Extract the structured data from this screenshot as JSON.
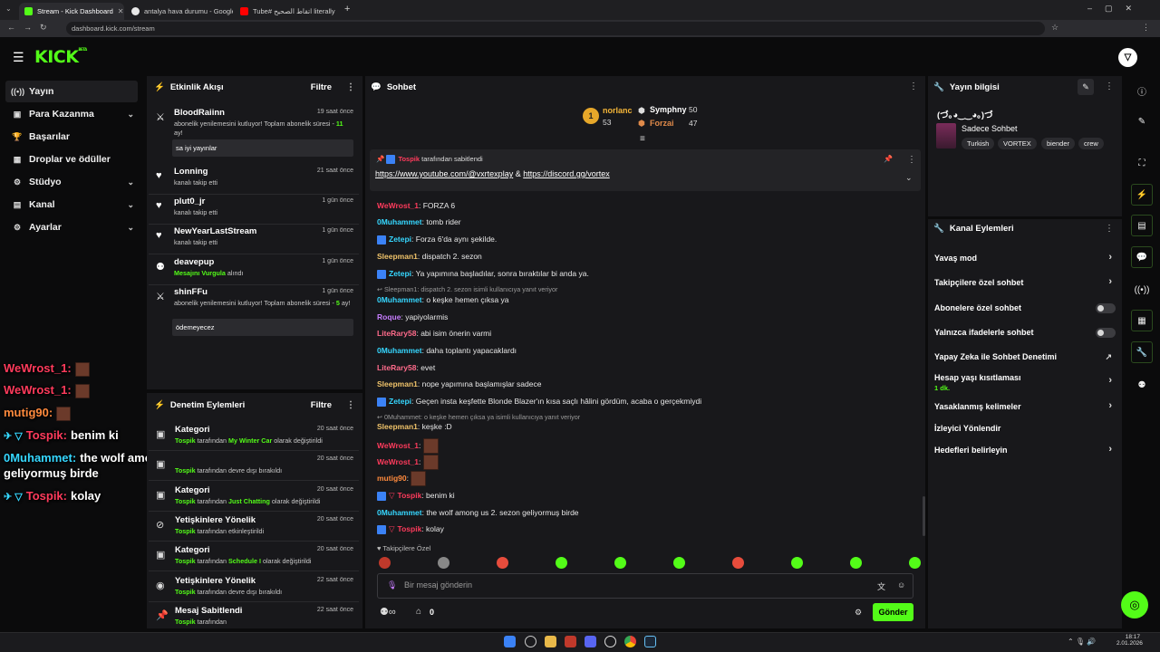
{
  "browser": {
    "tabs": [
      {
        "title": "Stream - Kick Dashboard",
        "color": "#53fc18"
      },
      {
        "title": "antalya hava durumu - Google",
        "color": "#e8e8e8"
      },
      {
        "title": "Tube#‎ اتقاط الصحيح literally",
        "color": "#ff0000"
      }
    ],
    "url": "dashboard.kick.com/stream"
  },
  "brand": {
    "logo": "KICK",
    "beta": "BETA",
    "accent": "#53fc18"
  },
  "nav": [
    {
      "label": "Yayın",
      "icon": "stream-icon"
    },
    {
      "label": "Para Kazanma",
      "icon": "wallet-icon",
      "chev": "⌄"
    },
    {
      "label": "Başarılar",
      "icon": "trophy-icon"
    },
    {
      "label": "Droplar ve ödüller",
      "icon": "gift-icon"
    },
    {
      "label": "Stüdyo",
      "icon": "studio-icon",
      "chev": "⌄"
    },
    {
      "label": "Kanal",
      "icon": "channel-icon",
      "chev": "⌄"
    },
    {
      "label": "Ayarlar",
      "icon": "gear-icon",
      "chev": "⌄"
    }
  ],
  "activity": {
    "title": "Etkinlik Akışı",
    "filter": "Filtre",
    "items": [
      {
        "name": "BloodRaiinn",
        "time": "19 saat önce",
        "desc": "abonelik yenilemesini kutluyor! Toplam abonelik süresi - ",
        "desc_em": "11",
        "desc_end": " ay!",
        "quote": "sa iyi yayınlar"
      },
      {
        "name": "Lonning",
        "time": "21 saat önce",
        "desc": "kanalı takip etti"
      },
      {
        "name": "plut0_jr",
        "time": "1 gün önce",
        "desc": "kanalı takip etti"
      },
      {
        "name": "NewYearLastStream",
        "time": "1 gün önce",
        "desc": "kanalı takip etti"
      },
      {
        "name": "deavepup",
        "time": "1 gün önce",
        "desc_em": "Mesajını Vurgula",
        "desc_end": " alındı"
      },
      {
        "name": "shinFFu",
        "time": "1 gün önce",
        "desc": "abonelik yenilemesini kutluyor! Toplam abonelik süresi - ",
        "desc_em": "5",
        "desc_end": " ay!",
        "quote": "ödemeyecez"
      }
    ]
  },
  "moderation": {
    "title": "Denetim Eylemleri",
    "filter": "Filtre",
    "items": [
      {
        "title": "Kategori",
        "time": "20 saat önce",
        "by": "Tospik",
        "pre": " tarafından ",
        "em": "My Winter Car",
        "post": " olarak değiştirildi"
      },
      {
        "title": "",
        "time": "20 saat önce",
        "by": "Tospik",
        "pre": " tarafından devre dışı bırakıldı",
        "em": "",
        "post": ""
      },
      {
        "title": "Kategori",
        "time": "20 saat önce",
        "by": "Tospik",
        "pre": " tarafından ",
        "em": "Just Chatting",
        "post": " olarak değiştirildi"
      },
      {
        "title": "Yetişkinlere Yönelik",
        "time": "20 saat önce",
        "by": "Tospik",
        "pre": " tarafından etkinleştirildi",
        "em": "",
        "post": ""
      },
      {
        "title": "Kategori",
        "time": "20 saat önce",
        "by": "Tospik",
        "pre": " tarafından ",
        "em": "Schedule I",
        "post": " olarak değiştirildi"
      },
      {
        "title": "Yetişkinlere Yönelik",
        "time": "22 saat önce",
        "by": "Tospik",
        "pre": " tarafından devre dışı bırakıldı",
        "em": "",
        "post": ""
      },
      {
        "title": "Mesaj Sabitlendi",
        "time": "22 saat önce",
        "by": "Tospik",
        "pre": " tarafından",
        "em": "",
        "post": ""
      }
    ]
  },
  "chat": {
    "title": "Sohbet",
    "leaders": [
      {
        "rank": "1",
        "name": "norlanc",
        "value": "53"
      },
      {
        "name": "Symphny",
        "value": "50"
      },
      {
        "name": "Forzai",
        "value": "47"
      }
    ],
    "pinned": {
      "by": "Tospik",
      "label": "tarafından sabitlendi",
      "text_a": "https://www.youtube.com/@vxrtexplay",
      "amp": " & ",
      "text_b": "https://discord.gg/vortex"
    },
    "messages": [
      {
        "user": "WeWrost_1",
        "color": "#ff3b5c",
        "text": "FORZA 6"
      },
      {
        "user": "0Muhammet",
        "color": "#36d7ff",
        "text": "tomb rider"
      },
      {
        "user": "Zetepi",
        "color": "#36d7ff",
        "text": "Forza 6'da aynı şekilde.",
        "badge": true
      },
      {
        "user": "Sleepman1",
        "color": "#f0c36a",
        "text": "dispatch 2. sezon"
      },
      {
        "user": "Zetepi",
        "color": "#36d7ff",
        "text": "Ya yapımına başladılar, sonra bıraktılar bi anda ya.",
        "badge": true
      },
      {
        "reply": "Sleepman1: dispatch 2. sezon isimli kullanıcıya yanıt veriyor"
      },
      {
        "user": "0Muhammet",
        "color": "#36d7ff",
        "text": "o keşke hemen çıksa ya"
      },
      {
        "user": "Roque",
        "color": "#c77dff",
        "text": "yapiyolarmis"
      },
      {
        "user": "LiteRary58",
        "color": "#ff6b8b",
        "text": "abi isim önerin varmi"
      },
      {
        "user": "0Muhammet",
        "color": "#36d7ff",
        "text": "daha toplantı yapacaklardı"
      },
      {
        "user": "LiteRary58",
        "color": "#ff6b8b",
        "text": "evet"
      },
      {
        "user": "Sleepman1",
        "color": "#f0c36a",
        "text": "nope yapımına başlamışlar sadece"
      },
      {
        "user": "Zetepi",
        "color": "#36d7ff",
        "text": "Geçen insta keşfette Blonde Blazer'ın kısa saçlı hâlini gördüm, acaba o gerçekmiydi",
        "badge": true
      },
      {
        "reply": "0Muhammet: o keşke hemen çıksa ya isimli kullanıcıya yanıt veriyor"
      },
      {
        "user": "Sleepman1",
        "color": "#f0c36a",
        "text": "keşke :D"
      },
      {
        "user": "WeWrost_1",
        "color": "#ff3b5c",
        "emote": true
      },
      {
        "user": "WeWrost_1",
        "color": "#ff3b5c",
        "emote": true
      },
      {
        "user": "mutig90",
        "color": "#ff8a3d",
        "emote": true
      },
      {
        "user": "Tospik",
        "color": "#ff3b5c",
        "text": "benim ki",
        "badge": true
      },
      {
        "user": "0Muhammet",
        "color": "#36d7ff",
        "text": "the wolf among us 2. sezon geliyormuş birde"
      },
      {
        "user": "Tospik",
        "color": "#ff3b5c",
        "text": "kolay",
        "badge": true
      }
    ],
    "followers_only": "Takipçilere Özel",
    "input_placeholder": "Bir mesaj gönderin",
    "points": "0",
    "send": "Gönder"
  },
  "stream_info": {
    "title": "Yayın bilgisi",
    "stream_title": "(づ｡◕‿‿◕｡)づ",
    "category": "Sadece Sohbet",
    "tags": [
      "Turkish",
      "VORTEX",
      "biender",
      "crew"
    ]
  },
  "channel_actions": {
    "title": "Kanal Eylemleri",
    "rows": [
      {
        "label": "Yavaş mod",
        "type": "chev"
      },
      {
        "label": "Takipçilere özel sohbet",
        "type": "chev"
      },
      {
        "label": "Abonelere özel sohbet",
        "type": "toggle"
      },
      {
        "label": "Yalnızca ifadelerle sohbet",
        "type": "toggle"
      },
      {
        "label": "Yapay Zeka ile Sohbet Denetimi",
        "type": "ext"
      },
      {
        "label": "Hesap yaşı kısıtlaması",
        "type": "chev",
        "sub": "1 dk."
      },
      {
        "label": "Yasaklanmış kelimeler",
        "type": "chev"
      },
      {
        "label": "İzleyici Yönlendir",
        "type": "none"
      },
      {
        "label": "Hedefleri belirleyin",
        "type": "chev"
      }
    ]
  },
  "overlay": [
    {
      "user": "WeWrost_1:",
      "emote": true,
      "color": "#ff3b5c"
    },
    {
      "user": "WeWrost_1:",
      "emote": true,
      "color": "#ff3b5c"
    },
    {
      "user": "mutig90:",
      "emote": true,
      "color": "#ff8a3d"
    },
    {
      "user": "Tospik:",
      "text": "benim ki",
      "color": "#ff3b5c",
      "badge": true
    },
    {
      "user": "0Muhammet:",
      "text": "the wolf among us 2. sezon geliyormuş birde",
      "color": "#36d7ff"
    },
    {
      "user": "Tospik:",
      "text": "kolay",
      "color": "#ff3b5c",
      "badge": true
    }
  ],
  "clock": {
    "time": "18:17",
    "date": "2.01.2026"
  }
}
